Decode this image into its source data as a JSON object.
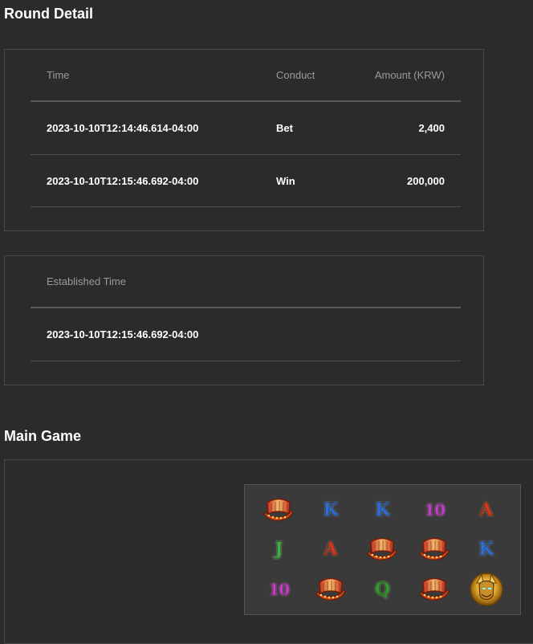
{
  "round_detail": {
    "title": "Round Detail",
    "headers": {
      "time": "Time",
      "conduct": "Conduct",
      "amount": "Amount (KRW)"
    },
    "rows": [
      {
        "time": "2023-10-10T12:14:46.614-04:00",
        "conduct": "Bet",
        "amount": "2,400"
      },
      {
        "time": "2023-10-10T12:15:46.692-04:00",
        "conduct": "Win",
        "amount": "200,000"
      }
    ]
  },
  "established": {
    "header": "Established Time",
    "value": "2023-10-10T12:15:46.692-04:00"
  },
  "main_game": {
    "title": "Main Game",
    "reels": [
      [
        {
          "type": "icon",
          "name": "viking-ship-icon"
        },
        {
          "type": "letter",
          "text": "K",
          "cls": "sym-k",
          "name": "k-symbol-icon"
        },
        {
          "type": "letter",
          "text": "K",
          "cls": "sym-k",
          "name": "k-symbol-icon"
        },
        {
          "type": "letter",
          "text": "10",
          "cls": "sym-10",
          "name": "ten-symbol-icon"
        },
        {
          "type": "letter",
          "text": "A",
          "cls": "sym-a",
          "name": "a-symbol-icon"
        }
      ],
      [
        {
          "type": "letter",
          "text": "J",
          "cls": "sym-j",
          "name": "j-symbol-icon"
        },
        {
          "type": "letter",
          "text": "A",
          "cls": "sym-a",
          "name": "a-symbol-icon"
        },
        {
          "type": "icon",
          "name": "viking-ship-icon"
        },
        {
          "type": "icon",
          "name": "viking-ship-icon"
        },
        {
          "type": "letter",
          "text": "K",
          "cls": "sym-k",
          "name": "k-symbol-icon"
        }
      ],
      [
        {
          "type": "letter",
          "text": "10",
          "cls": "sym-10",
          "name": "ten-symbol-icon"
        },
        {
          "type": "icon",
          "name": "viking-ship-icon"
        },
        {
          "type": "letter",
          "text": "Q",
          "cls": "sym-q",
          "name": "q-symbol-icon"
        },
        {
          "type": "icon",
          "name": "viking-ship-icon"
        },
        {
          "type": "icon",
          "name": "viking-warrior-icon"
        }
      ]
    ]
  }
}
